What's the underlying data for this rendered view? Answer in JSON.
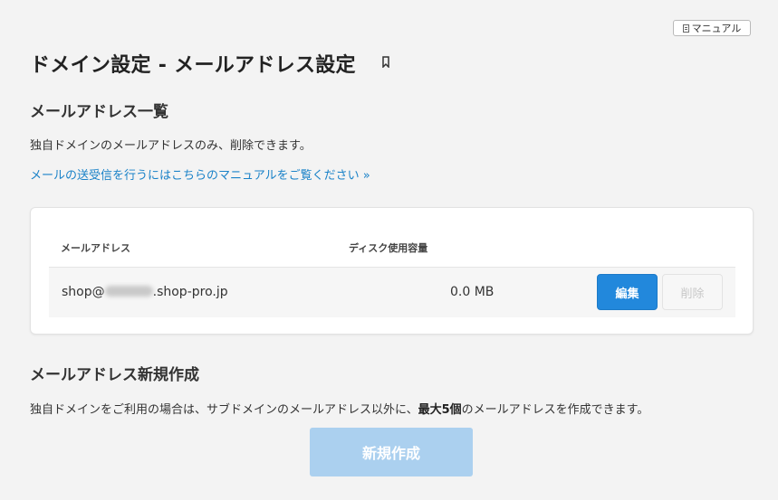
{
  "header": {
    "manual_button_label": "マニュアル",
    "title": "ドメイン設定 - メールアドレス設定"
  },
  "list_section": {
    "title": "メールアドレス一覧",
    "description": "独自ドメインのメールアドレスのみ、削除できます。",
    "manual_link": "メールの送受信を行うにはこちらのマニュアルをご覧ください »",
    "columns": [
      "メールアドレス",
      "ディスク使用容量"
    ],
    "rows": [
      {
        "email_prefix": "shop@",
        "email_suffix": ".shop-pro.jp",
        "disk_usage": "0.0 MB",
        "edit_label": "編集",
        "delete_label": "削除"
      }
    ]
  },
  "create_section": {
    "title": "メールアドレス新規作成",
    "description_before": "独自ドメインをご利用の場合は、サブドメインのメールアドレス以外に、",
    "description_bold": "最大5個",
    "description_after": "のメールアドレスを作成できます。",
    "create_button_label": "新規作成"
  },
  "colors": {
    "link": "#1a82c8",
    "primary_button": "#2288dc",
    "disabled_button": "#abd0ef",
    "background": "#f3f3f3"
  }
}
